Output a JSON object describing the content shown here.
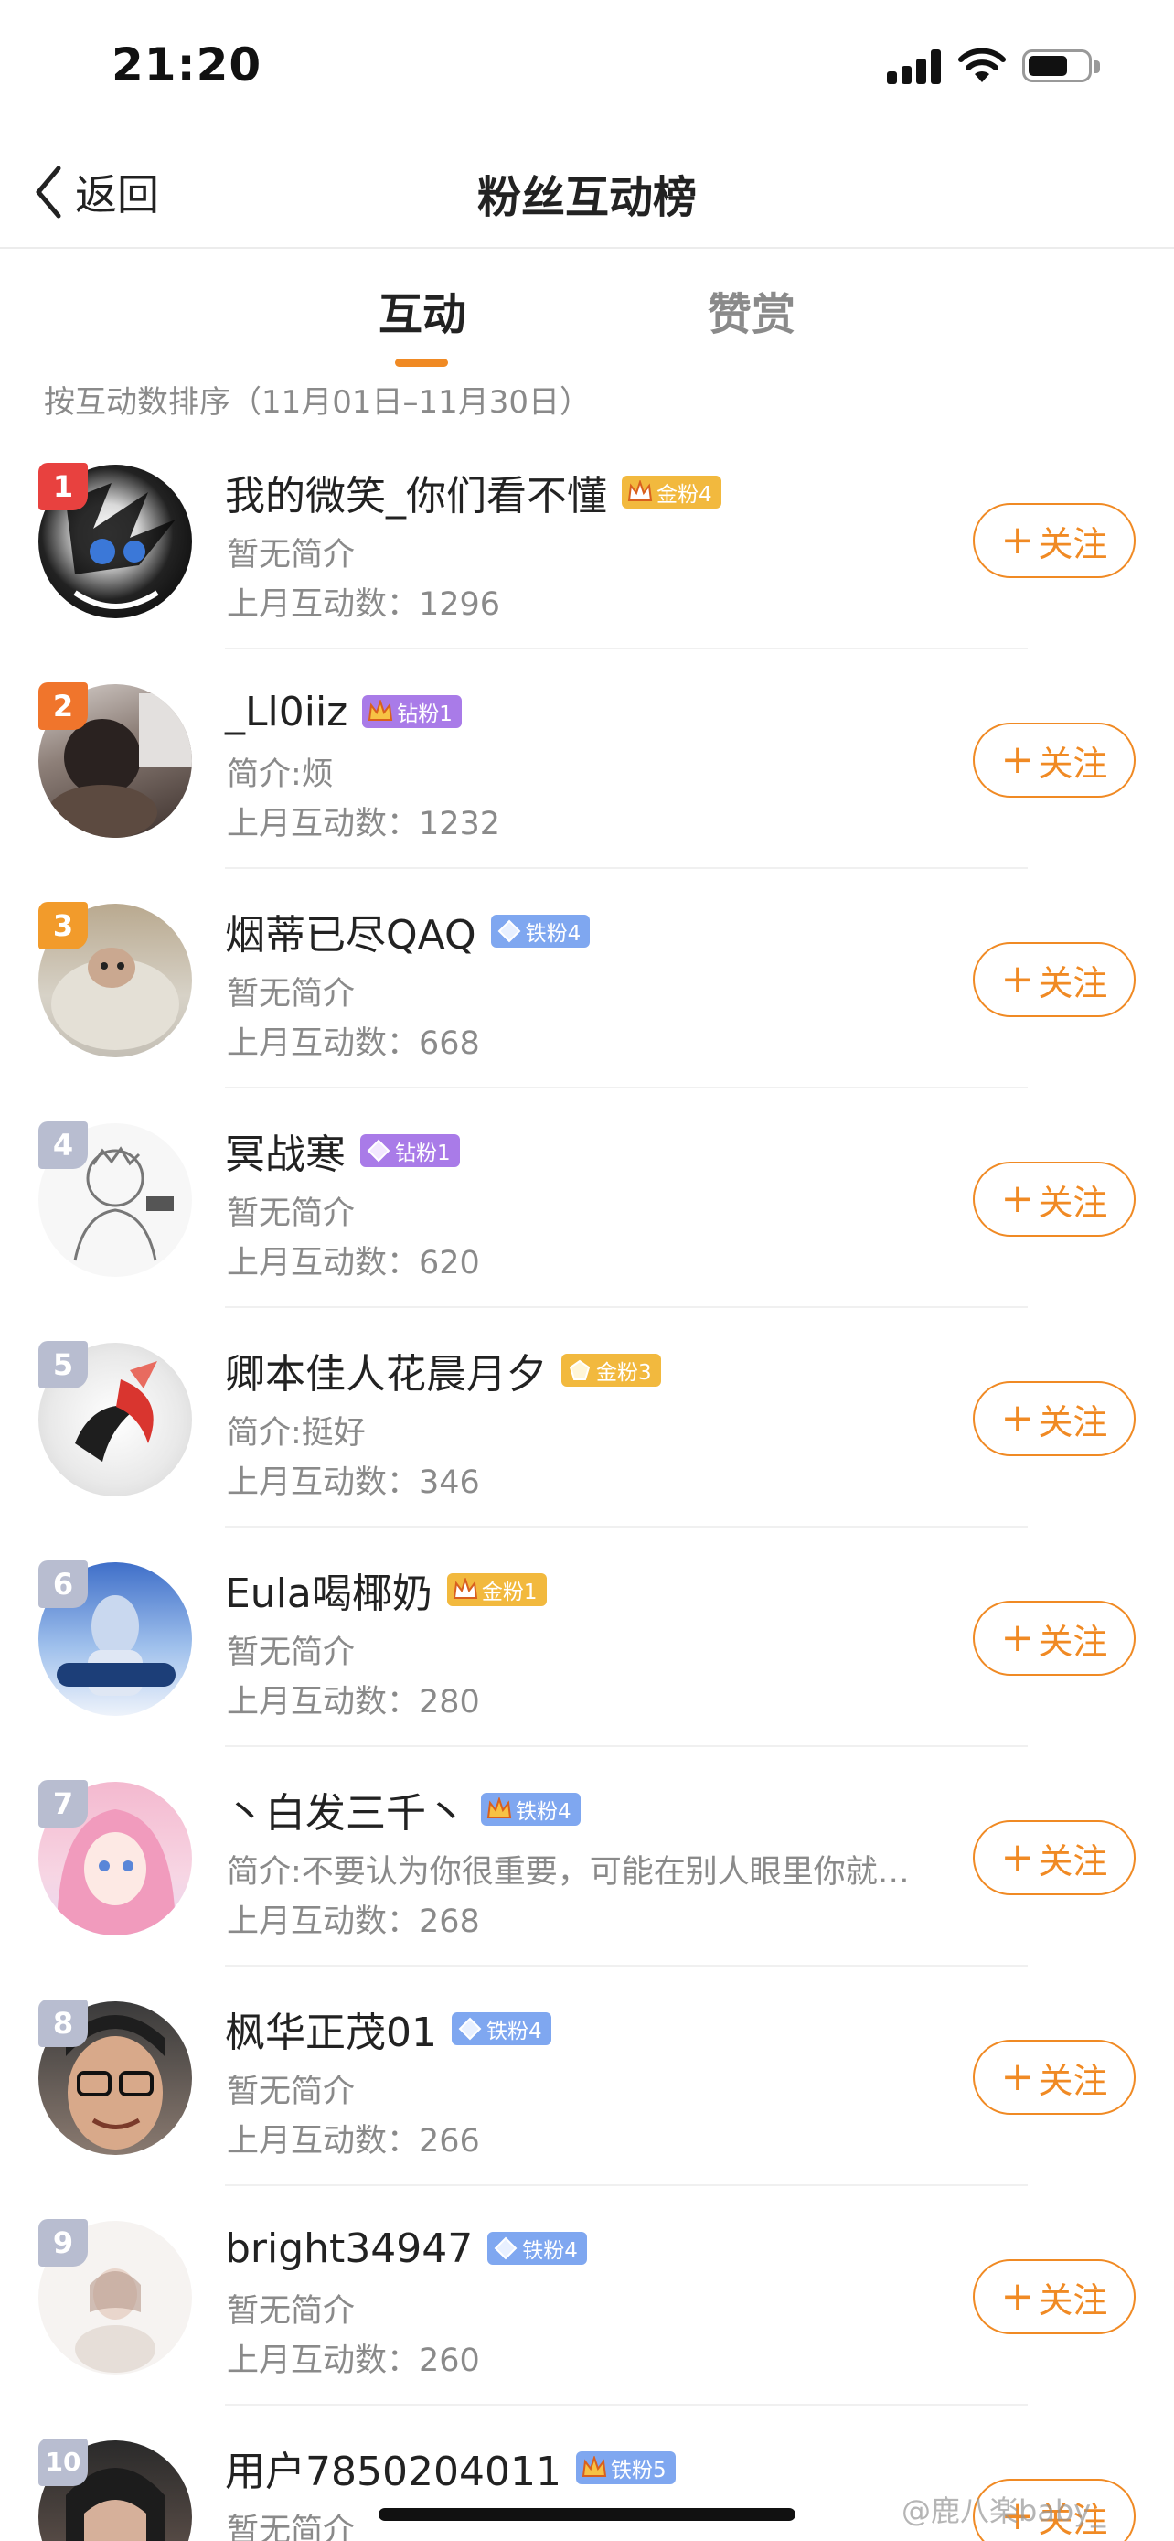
{
  "status_bar": {
    "time": "21:20"
  },
  "nav": {
    "back_label": "返回",
    "title": "粉丝互动榜"
  },
  "tabs": [
    {
      "label": "互动",
      "active": true
    },
    {
      "label": "赞赏",
      "active": false
    }
  ],
  "sort_caption": "按互动数排序（11月01日–11月30日）",
  "follow_label": "关注",
  "colors": {
    "accent": "#f08a24",
    "rank_1": "#e8413f",
    "rank_2": "#f0752c",
    "rank_3": "#f29b2b",
    "rank_other": "#b8bdd0",
    "badge_gold": "#f2b93e",
    "badge_diamond": "#a97be8",
    "badge_iron": "#7fa7f0"
  },
  "fans": [
    {
      "rank": "1",
      "name": "我的微笑_你们看不懂",
      "badge": "金粉4",
      "badge_type": "gold",
      "badge_icon": "crown-icon",
      "bio": "暂无简介",
      "count": "上月互动数：1296"
    },
    {
      "rank": "2",
      "name": "_Ll0iiz",
      "badge": "钻粉1",
      "badge_type": "diamond",
      "badge_icon": "crown-icon",
      "bio": "简介:烦",
      "count": "上月互动数：1232"
    },
    {
      "rank": "3",
      "name": "烟蒂已尽QAQ",
      "badge": "铁粉4",
      "badge_type": "iron",
      "badge_icon": "gem-icon",
      "bio": "暂无简介",
      "count": "上月互动数：668"
    },
    {
      "rank": "4",
      "name": "冥战寒",
      "badge": "钻粉1",
      "badge_type": "diamond",
      "badge_icon": "gem-icon",
      "bio": "暂无简介",
      "count": "上月互动数：620"
    },
    {
      "rank": "5",
      "name": "卿本佳人花晨月夕",
      "badge": "金粉3",
      "badge_type": "gold",
      "badge_icon": "gem-icon",
      "bio": "简介:挺好",
      "count": "上月互动数：346"
    },
    {
      "rank": "6",
      "name": "Eula喝椰奶",
      "badge": "金粉1",
      "badge_type": "gold",
      "badge_icon": "crown-icon",
      "bio": "暂无简介",
      "count": "上月互动数：280"
    },
    {
      "rank": "7",
      "name": "丶白发三千丶",
      "badge": "铁粉4",
      "badge_type": "iron",
      "badge_icon": "crown-icon",
      "bio": "简介:不要认为你很重要，可能在别人眼里你就…",
      "count": "上月互动数：268"
    },
    {
      "rank": "8",
      "name": "枫华正茂01",
      "badge": "铁粉4",
      "badge_type": "iron",
      "badge_icon": "gem-icon",
      "bio": "暂无简介",
      "count": "上月互动数：266"
    },
    {
      "rank": "9",
      "name": "bright34947",
      "badge": "铁粉4",
      "badge_type": "iron",
      "badge_icon": "gem-icon",
      "bio": "暂无简介",
      "count": "上月互动数：260"
    },
    {
      "rank": "10",
      "name": "用户7850204011",
      "badge": "铁粉5",
      "badge_type": "iron",
      "badge_icon": "crown-icon",
      "bio": "暂无简介",
      "count": ""
    }
  ],
  "watermark": "@鹿八楽baby_"
}
